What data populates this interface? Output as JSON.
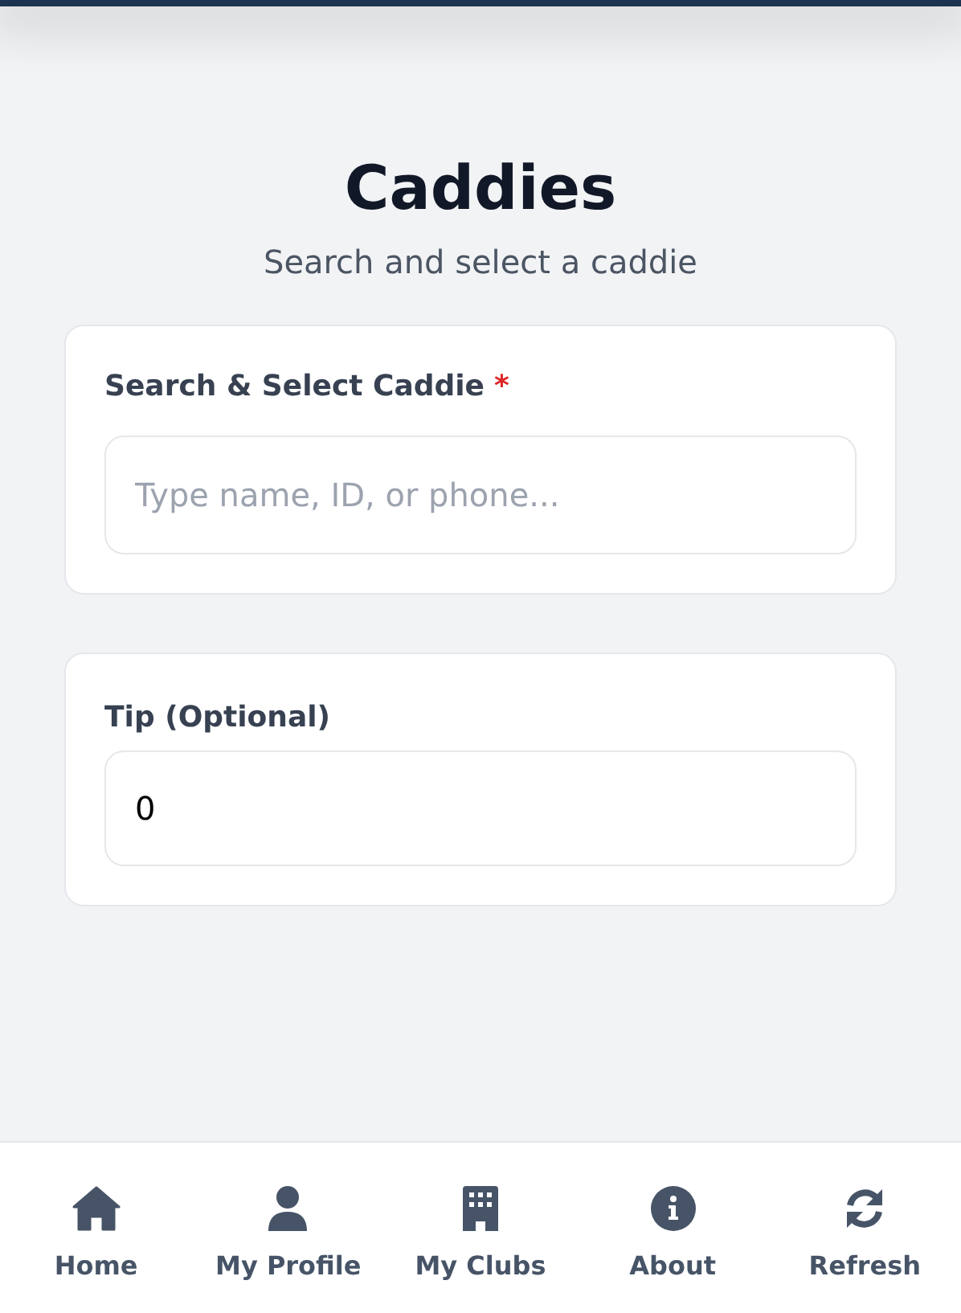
{
  "header": {
    "title": "Caddies",
    "subtitle": "Search and select a caddie"
  },
  "cards": [
    {
      "label": "Search & Select Caddie",
      "required_mark": "*",
      "placeholder": "Type name, ID, or phone..."
    },
    {
      "label": "Tip (Optional)",
      "value": "0"
    }
  ],
  "nav": [
    {
      "kind": "home",
      "label": "Home"
    },
    {
      "kind": "user",
      "label": "My Profile"
    },
    {
      "kind": "building",
      "label": "My Clubs"
    },
    {
      "kind": "info",
      "label": "About"
    },
    {
      "kind": "refresh",
      "label": "Refresh"
    }
  ]
}
